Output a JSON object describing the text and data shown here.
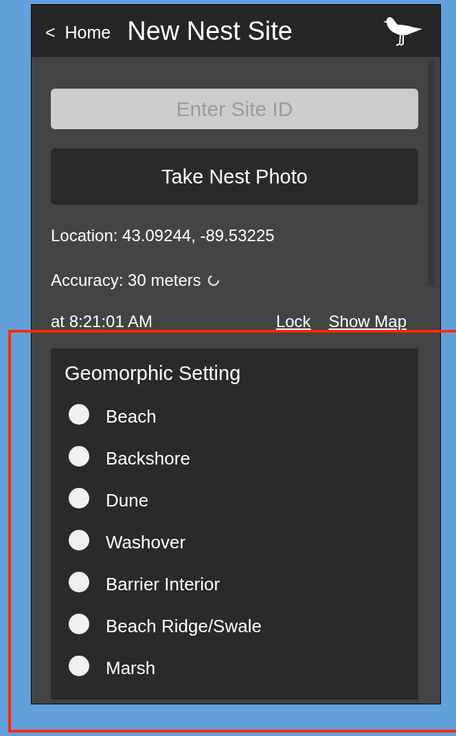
{
  "header": {
    "back_chevron": "<",
    "back_label": "Home",
    "title": "New Nest Site"
  },
  "site_id": {
    "placeholder": "Enter Site ID"
  },
  "photo_button": {
    "label": "Take Nest Photo"
  },
  "location": "Location: 43.09244, -89.53225",
  "accuracy": "Accuracy: 30 meters",
  "time": "at 8:21:01 AM",
  "links": [
    "Lock",
    "Show Map"
  ],
  "geomorphic_setting": {
    "legend": "Geomorphic Setting",
    "options": [
      {
        "label": "Beach",
        "selected": false
      },
      {
        "label": "Backshore",
        "selected": false
      },
      {
        "label": "Dune",
        "selected": false
      },
      {
        "label": "Washover",
        "selected": false
      },
      {
        "label": "Barrier Interior",
        "selected": false
      },
      {
        "label": "Beach Ridge/Swale",
        "selected": false
      },
      {
        "label": "Marsh",
        "selected": false
      }
    ]
  }
}
